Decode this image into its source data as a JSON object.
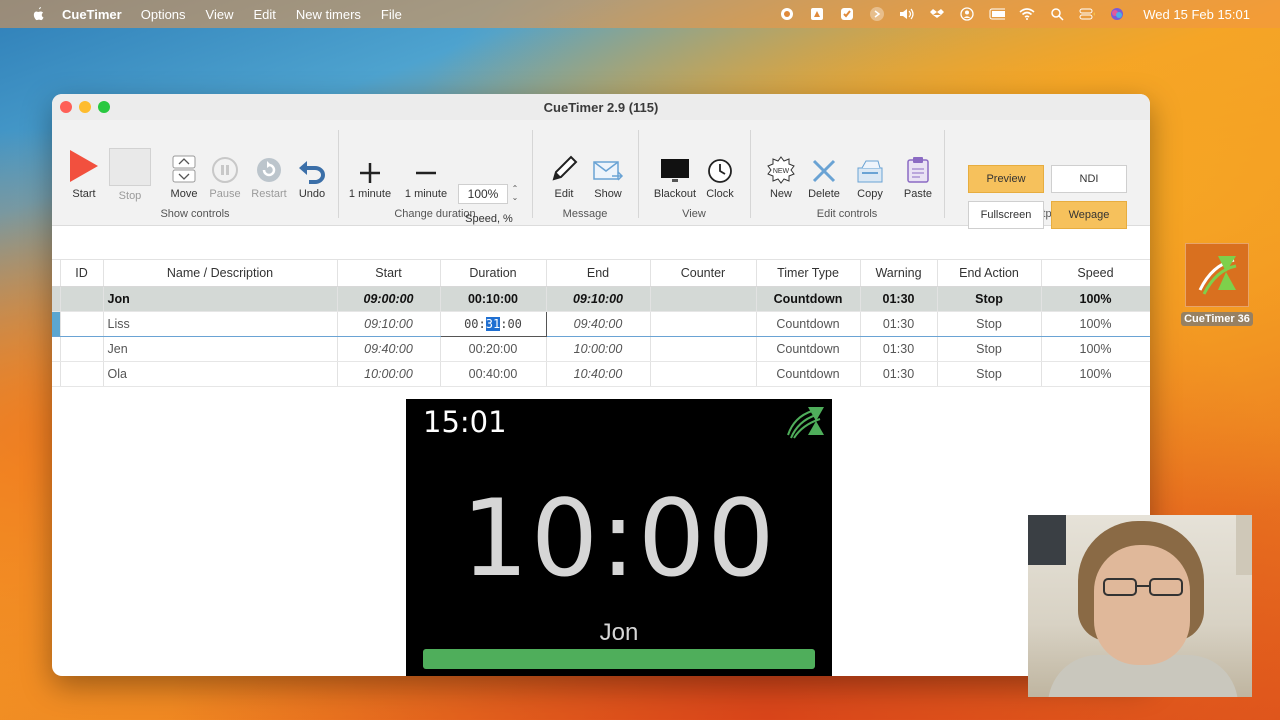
{
  "menubar": {
    "app_name": "CueTimer",
    "items": [
      "Options",
      "View",
      "Edit",
      "New timers",
      "File"
    ],
    "clock": "Wed 15 Feb  15:01"
  },
  "desktop_icon": {
    "label": "CueTimer 36"
  },
  "window": {
    "title": "CueTimer 2.9 (115)"
  },
  "toolbar": {
    "show_controls": {
      "label": "Show controls",
      "buttons": {
        "start": "Start",
        "stop": "Stop",
        "move": "Move",
        "pause": "Pause",
        "restart": "Restart",
        "undo": "Undo"
      }
    },
    "change_duration": {
      "label": "Change duration",
      "plus": "1 minute",
      "minus": "1 minute",
      "speed_value": "100%",
      "speed_label": "Speed, %"
    },
    "message": {
      "label": "Message",
      "edit": "Edit",
      "show": "Show"
    },
    "view": {
      "label": "View",
      "blackout": "Blackout",
      "clock": "Clock"
    },
    "edit_controls": {
      "label": "Edit controls",
      "new": "New",
      "delete": "Delete",
      "copy": "Copy",
      "paste": "Paste",
      "new_badge": "NEW"
    },
    "outputs": {
      "label": "Outputs",
      "preview": "Preview",
      "ndi": "NDI",
      "fullscreen": "Fullscreen",
      "webpage": "Wepage"
    }
  },
  "table": {
    "headers": [
      "ID",
      "Name / Description",
      "Start",
      "Duration",
      "End",
      "Counter",
      "Timer Type",
      "Warning",
      "End Action",
      "Speed"
    ],
    "rows": [
      {
        "id": "",
        "name": "Jon",
        "start": "09:00:00",
        "duration": "00:10:00",
        "end": "09:10:00",
        "counter": "",
        "type": "Countdown",
        "warning": "01:30",
        "end_action": "Stop",
        "speed": "100%"
      },
      {
        "id": "",
        "name": "Liss",
        "start": "09:10:00",
        "duration_pre": "00:",
        "duration_sel": "31",
        "duration_post": ":00",
        "end": "09:40:00",
        "counter": "",
        "type": "Countdown",
        "warning": "01:30",
        "end_action": "Stop",
        "speed": "100%"
      },
      {
        "id": "",
        "name": "Jen",
        "start": "09:40:00",
        "duration": "00:20:00",
        "end": "10:00:00",
        "counter": "",
        "type": "Countdown",
        "warning": "01:30",
        "end_action": "Stop",
        "speed": "100%"
      },
      {
        "id": "",
        "name": "Ola",
        "start": "10:00:00",
        "duration": "00:40:00",
        "end": "10:40:00",
        "counter": "",
        "type": "Countdown",
        "warning": "01:30",
        "end_action": "Stop",
        "speed": "100%"
      }
    ]
  },
  "preview": {
    "clock": "15:01",
    "countdown": "10:00",
    "name": "Jon",
    "progress": 1.0,
    "bar_color": "#4fae5b"
  }
}
